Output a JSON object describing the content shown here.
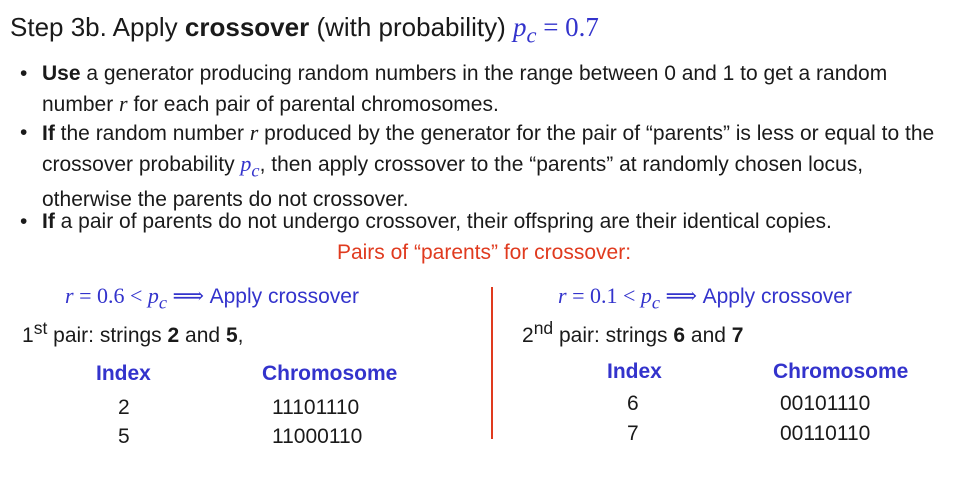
{
  "title": {
    "prefix": "Step 3b. Apply ",
    "bold": "crossover",
    "suffix": " (with probability) ",
    "var": "p",
    "sub": "c",
    "rest": " = 0.7"
  },
  "bullets": [
    {
      "bold": "Use",
      "text_a": " a generator producing random numbers in the range between 0 and 1 to get a random number ",
      "var": "r",
      "text_b": " for each pair of parental chromosomes."
    },
    {
      "bold": "If",
      "text_a": " the random number ",
      "var": "r",
      "text_b": " produced by the generator for the pair of “parents” is less or equal to the crossover probability ",
      "var2": "p",
      "sub2": "c",
      "text_c": ", then apply crossover to the “parents” at randomly chosen locus, otherwise the parents do not crossover."
    },
    {
      "bold": "If",
      "text_a": " a pair of parents do not undergo crossover, their offspring are their identical copies."
    }
  ],
  "pairs_heading": "Pairs of “parents” for crossover:",
  "left": {
    "cond_math_a": "r",
    "cond_math_b": " = 0.6 < ",
    "cond_math_c": "p",
    "cond_sub": "c",
    "cond_arrow": " ⟹ ",
    "cond_text": "Apply crossover",
    "pair_num": "1",
    "pair_sup": "st",
    "pair_text_a": " pair: strings ",
    "pair_s1": "2",
    "pair_and": " and ",
    "pair_s2": "5",
    "pair_end": ",",
    "col_index": "Index",
    "col_chrom": "Chromosome",
    "rows": [
      {
        "index": "2",
        "chromosome": "11101110"
      },
      {
        "index": "5",
        "chromosome": "11000110"
      }
    ]
  },
  "right": {
    "cond_math_a": "r",
    "cond_math_b": " = 0.1 < ",
    "cond_math_c": "p",
    "cond_sub": "c",
    "cond_arrow": " ⟹ ",
    "cond_text": "Apply crossover",
    "pair_num": "2",
    "pair_sup": "nd",
    "pair_text_a": " pair: strings ",
    "pair_s1": "6",
    "pair_and": " and ",
    "pair_s2": "7",
    "pair_end": "",
    "col_index": "Index",
    "col_chrom": "Chromosome",
    "rows": [
      {
        "index": "6",
        "chromosome": "00101110"
      },
      {
        "index": "7",
        "chromosome": "00110110"
      }
    ]
  },
  "colors": {
    "accent_blue": "#3333cc",
    "accent_red": "#e03a1e"
  }
}
